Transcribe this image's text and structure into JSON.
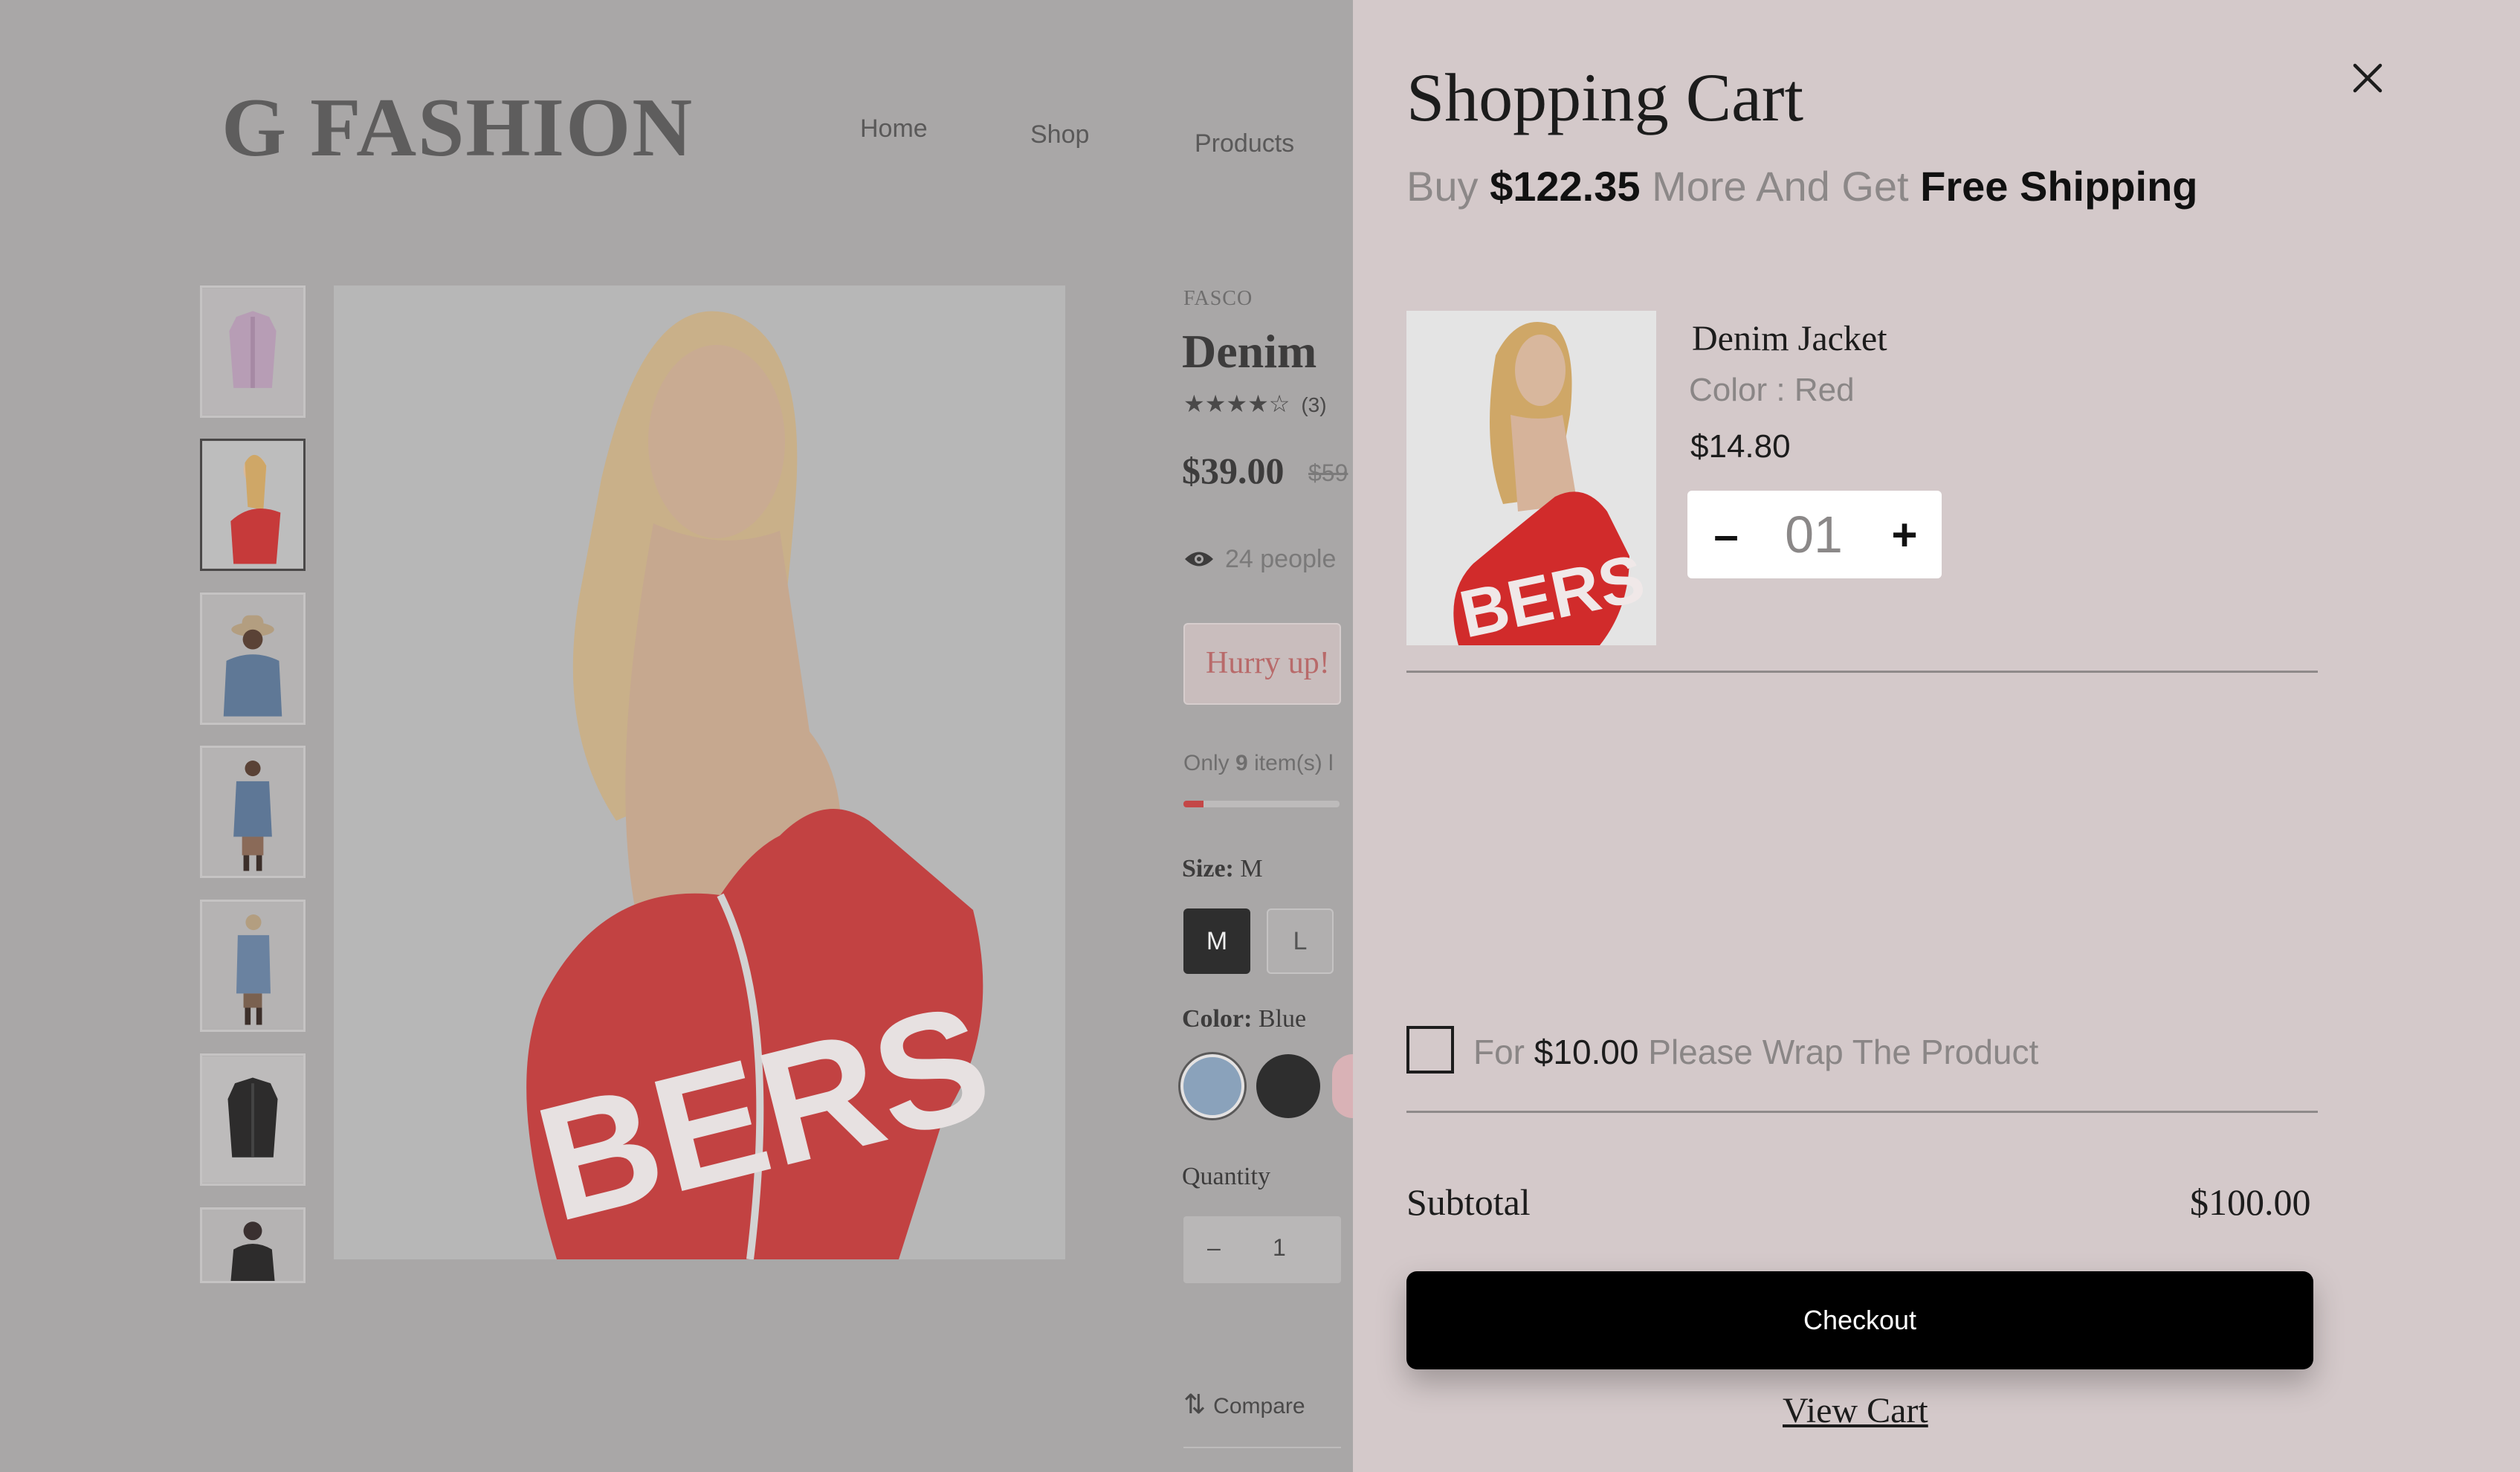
{
  "colors": {
    "overlay_bg": "#a9a7a7",
    "drawer_bg": "#d4c9ca",
    "accent_red": "#c44747",
    "checkout_bg": "#000000"
  },
  "header": {
    "logo": "G FASHION",
    "nav": [
      "Home",
      "Shop",
      "Products"
    ]
  },
  "product": {
    "brand": "FASCO",
    "title": "Denim",
    "rating_stars": "★★★★☆",
    "rating_count": "(3)",
    "price": "$39.00",
    "old_price": "$59",
    "viewers_text": "24 people",
    "hurry_label": "Hurry up!",
    "stock_prefix": "Only",
    "stock_count": "9",
    "stock_suffix": "item(s) l",
    "stock_level": 0.13,
    "size_label": "Size:",
    "size_value": "M",
    "sizes": [
      "M",
      "L"
    ],
    "color_label": "Color:",
    "color_value": "Blue",
    "swatches": [
      "#8aa2bb",
      "#2e2e2e"
    ],
    "quantity_label": "Quantity",
    "quantity_minus": "–",
    "quantity_value": "1",
    "compare_label": "Compare",
    "thumbnail_icons": [
      "purple-shirt-thumb",
      "red-jacket-thumb",
      "denim-hat-thumb",
      "denim-jacket-thumb",
      "denim-jacket-side-thumb",
      "black-jacket-thumb",
      "black-outfit-thumb"
    ]
  },
  "cart": {
    "title": "Shopping Cart",
    "shipping_prefix": "Buy",
    "shipping_amount": "$122.35",
    "shipping_middle": "More And Get",
    "shipping_bold": "Free Shipping",
    "item": {
      "name": "Denim Jacket",
      "color": "Color : Red",
      "price": "$14.80",
      "qty_minus": "–",
      "qty": "01",
      "qty_plus": "+"
    },
    "wrap_prefix": "For",
    "wrap_amount": "$10.00",
    "wrap_suffix": "Please Wrap The Product",
    "subtotal_label": "Subtotal",
    "subtotal_value": "$100.00",
    "checkout_label": "Checkout",
    "view_cart_label": "View Cart"
  }
}
